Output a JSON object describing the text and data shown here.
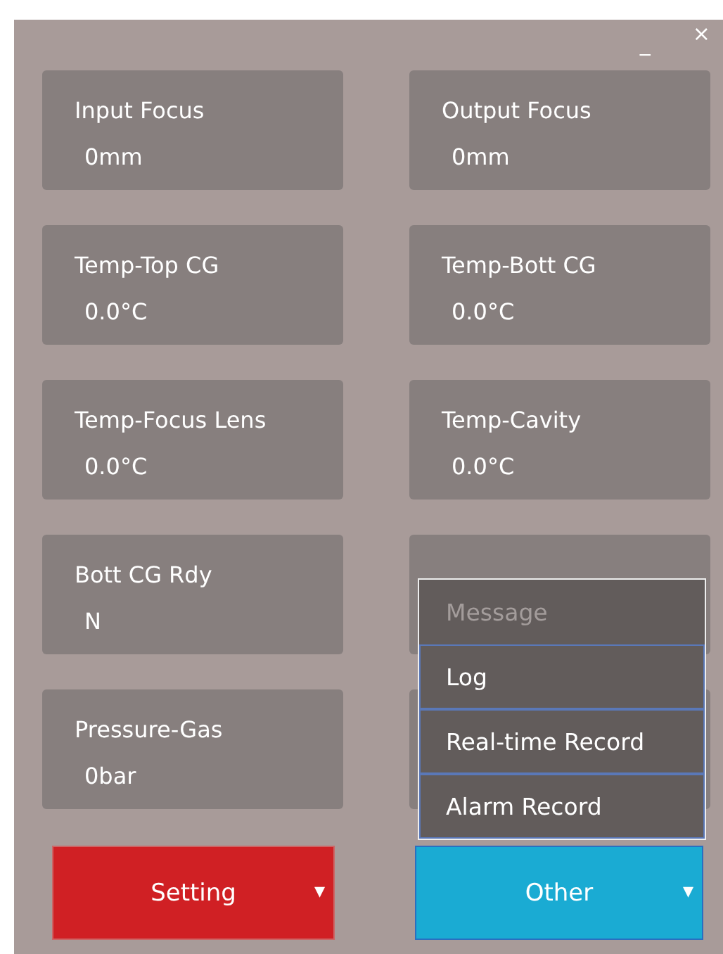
{
  "window": {
    "minimize": "_",
    "close": "×"
  },
  "cards": [
    {
      "kind": "readout",
      "label": "Input Focus",
      "value": "0mm"
    },
    {
      "kind": "readout",
      "label": "Output Focus",
      "value": "0mm"
    },
    {
      "kind": "readout",
      "label": "Temp-Top CG",
      "value": "0.0°C"
    },
    {
      "kind": "readout",
      "label": "Temp-Bott CG",
      "value": "0.0°C"
    },
    {
      "kind": "readout",
      "label": "Temp-Focus Lens",
      "value": "0.0°C"
    },
    {
      "kind": "readout",
      "label": "Temp-Cavity",
      "value": "0.0°C"
    },
    {
      "kind": "readout",
      "label": "Bott CG Rdy",
      "value": "N"
    },
    {
      "kind": "blank"
    },
    {
      "kind": "readout",
      "label": "Pressure-Gas",
      "value": "0bar"
    },
    {
      "kind": "blank"
    }
  ],
  "buttons": [
    {
      "label": "Setting",
      "kind": "setting",
      "arrow": "▾"
    },
    {
      "label": "Other",
      "kind": "other",
      "arrow": "▾",
      "expanded": true
    }
  ],
  "menu": [
    {
      "label": "Message",
      "disabled": true
    },
    {
      "label": "Log",
      "disabled": false
    },
    {
      "label": "Real-time Record",
      "disabled": false
    },
    {
      "label": "Alarm Record",
      "disabled": false
    }
  ]
}
